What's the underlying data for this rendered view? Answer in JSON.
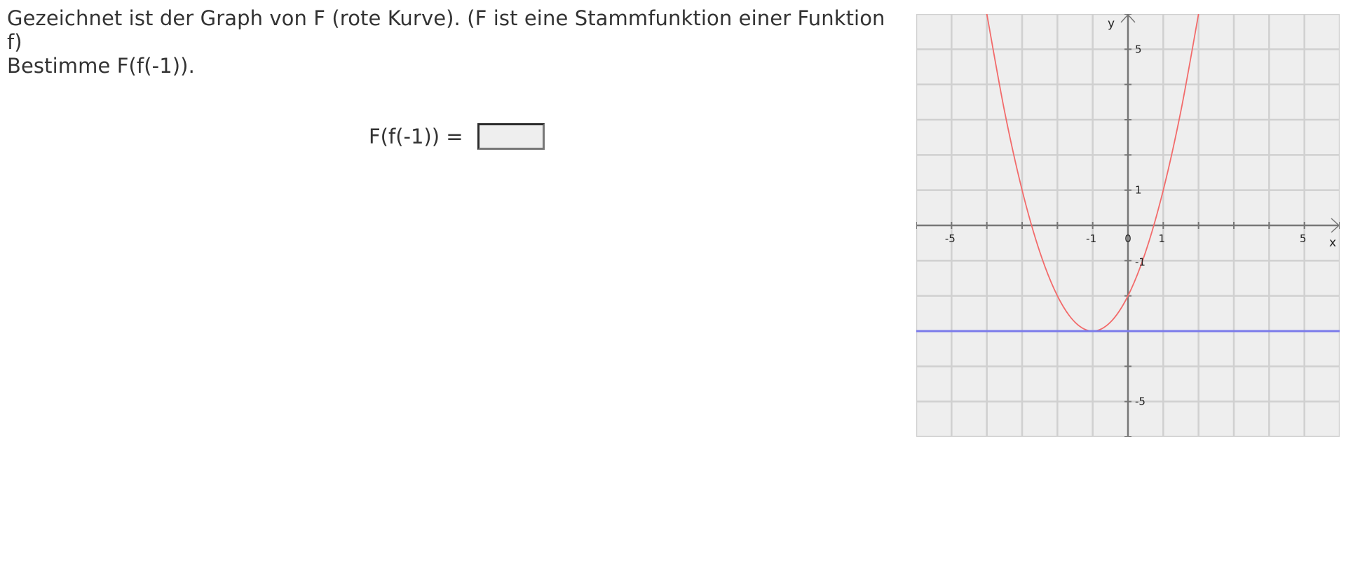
{
  "task": {
    "line1": "Gezeichnet ist der Graph von F (rote Kurve). (F ist eine Stammfunktion einer Funktion f)",
    "line2": "Bestimme F(f(-1))."
  },
  "answer": {
    "label": "F(f(-1)) =",
    "value": "",
    "placeholder": ""
  },
  "colors": {
    "curve": "#f26b6b",
    "horizontal_line": "#7b7bea",
    "grid": "#d0d0d0",
    "plot_background": "#eeeeee",
    "axis": "#777777"
  },
  "chart_data": {
    "type": "line",
    "title": "",
    "xlabel": "x",
    "ylabel": "y",
    "xlim": [
      -6,
      6
    ],
    "ylim": [
      -6,
      6
    ],
    "grid": true,
    "x_tick_labels": [
      "-5",
      "-1",
      "0",
      "1",
      "5"
    ],
    "y_tick_labels": [
      "5",
      "1",
      "-1",
      "-5"
    ],
    "series": [
      {
        "color": "#f26b6b",
        "x": [
          -4.0,
          -3.5,
          -3.0,
          -2.5,
          -2.0,
          -1.5,
          -1.0,
          -0.5,
          0.0,
          0.5,
          1.0,
          1.5,
          2.0
        ],
        "y": [
          6.0,
          3.25,
          1.0,
          -0.75,
          -2.0,
          -2.75,
          -3.0,
          -2.75,
          -2.0,
          -0.75,
          1.0,
          3.25,
          6.0
        ]
      },
      {
        "color": "#7b7bea",
        "x": [
          -6,
          6
        ],
        "y": [
          -3,
          -3
        ]
      }
    ]
  }
}
